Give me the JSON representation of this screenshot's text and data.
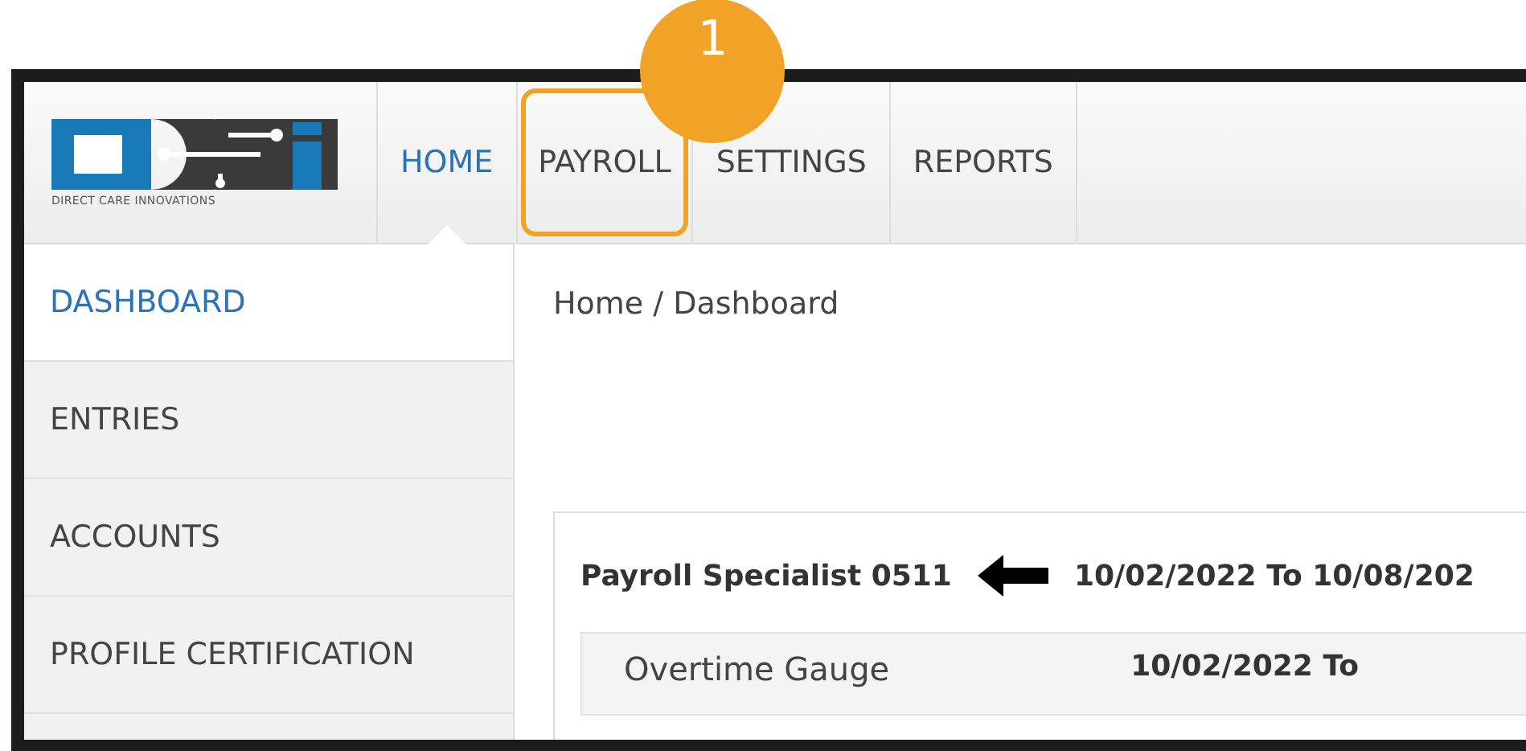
{
  "logo": {
    "tagline": "DIRECT CARE INNOVATIONS"
  },
  "nav": [
    {
      "label": "HOME",
      "selected": true,
      "highlighted": false
    },
    {
      "label": "PAYROLL",
      "selected": false,
      "highlighted": true
    },
    {
      "label": "SETTINGS",
      "selected": false,
      "highlighted": false
    },
    {
      "label": "REPORTS",
      "selected": false,
      "highlighted": false
    }
  ],
  "callout": {
    "label": "1"
  },
  "sidebar": {
    "items": [
      {
        "label": "DASHBOARD",
        "selected": true
      },
      {
        "label": "ENTRIES",
        "selected": false
      },
      {
        "label": "ACCOUNTS",
        "selected": false
      },
      {
        "label": "PROFILE CERTIFICATION",
        "selected": false
      }
    ]
  },
  "breadcrumb": "Home / Dashboard",
  "card": {
    "title": "Payroll Specialist 0511",
    "period": "10/02/2022 To 10/08/202",
    "panel": {
      "title": "Overtime Gauge",
      "period": "10/02/2022 To"
    }
  }
}
